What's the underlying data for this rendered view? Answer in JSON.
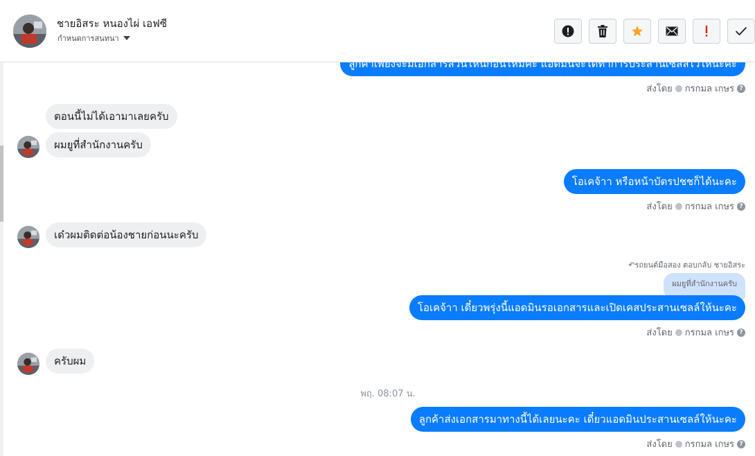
{
  "header": {
    "contact_name": "ชายอิสระ หนองไผ่ เอฟซี",
    "conversation_setting": "กำหนดการสนทนา"
  },
  "actions": [
    {
      "name": "mark-spam",
      "icon": "exclamation-circle-icon"
    },
    {
      "name": "delete",
      "icon": "trash-icon"
    },
    {
      "name": "star",
      "icon": "star-icon"
    },
    {
      "name": "mark-unread",
      "icon": "envelope-icon"
    },
    {
      "name": "important",
      "icon": "exclamation-icon"
    },
    {
      "name": "done",
      "icon": "checkmark-icon"
    }
  ],
  "colors": {
    "outgoing_bubble": "#0a7cff",
    "incoming_bubble": "#eeeff1",
    "reply_quote": "#cfe2fc",
    "star": "#f5a623",
    "important": "#e02020"
  },
  "messages": {
    "m0_text": "ลูกค้าเพียงจะมีเอกสารส่วนไหนก่อนไหมคะ แอดมินจะได้ทำการประสานเซลล์ไว้ให้นะคะ",
    "m0_meta": "ส่งโดย",
    "m0_sender": "กรกมล เกษร",
    "m1_text": "ตอนนี้ไม่ได้เอามาเลยครับ",
    "m2_text": "ผมยูที่สำนักงานครับ",
    "m3_text": "โอเคจ้าา หรือหน้าบัตรปชชก็ได้นะคะ",
    "m3_meta": "ส่งโดย",
    "m3_sender": "กรกมล เกษร",
    "m4_text": "เด๋วผมติดต่อน้องชายก่อนนะครับ",
    "reply_note": "รถยนต์มือสอง ตอบกลับ ชายอิสระ",
    "reply_quote": "ผมยูที่สำนักงานครับ",
    "m5_text": "โอเคจ้าา เดี๋ยวพรุ่งนี้แอดมินรอเอกสารและเปิดเคสประสานเซลล์ให้นะคะ",
    "m5_meta": "ส่งโดย",
    "m5_sender": "กรกมล เกษร",
    "m6_text": "ครับผม",
    "date_separator": "พฤ. 08:07 น.",
    "m7_text": "ลูกค้าส่งเอกสารมาทางนี้ได้เลยนะคะ เดี๋ยวแอดมินประสานเซลล์ให้นะคะ",
    "m7_meta": "ส่งโดย",
    "m7_sender": "กรกมล เกษร"
  }
}
